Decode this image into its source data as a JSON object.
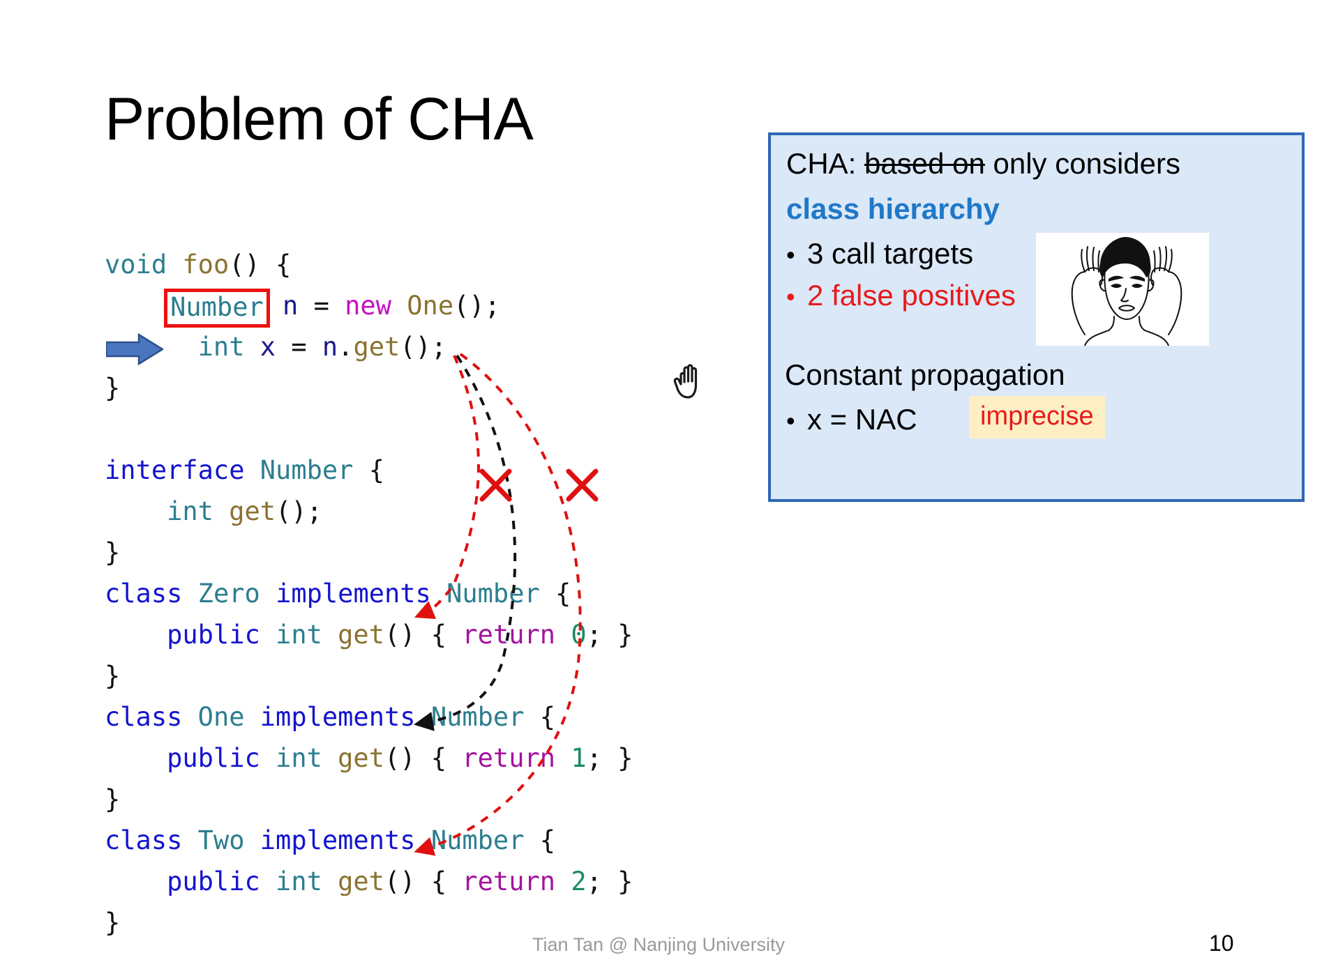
{
  "slide": {
    "title": "Problem of CHA",
    "page_number": "10",
    "footer": "Tian Tan @ Nanjing University"
  },
  "code": {
    "lines": [
      {
        "id": "line-void-foo",
        "tokens": [
          {
            "t": "void",
            "c": "type"
          },
          {
            "t": " ",
            "c": "punc"
          },
          {
            "t": "foo",
            "c": "meth"
          },
          {
            "t": "() {",
            "c": "punc"
          }
        ]
      },
      {
        "id": "line-number-n",
        "tokens": [
          {
            "t": "    ",
            "c": "punc"
          },
          {
            "t": "Number",
            "c": "type",
            "box": true
          },
          {
            "t": " ",
            "c": "punc"
          },
          {
            "t": "n",
            "c": "var"
          },
          {
            "t": " = ",
            "c": "punc"
          },
          {
            "t": "new",
            "c": "newkw"
          },
          {
            "t": " ",
            "c": "punc"
          },
          {
            "t": "One",
            "c": "meth"
          },
          {
            "t": "();",
            "c": "punc"
          }
        ]
      },
      {
        "id": "line-int-x",
        "tokens": [
          {
            "t": "      ",
            "c": "punc"
          },
          {
            "t": "int",
            "c": "type"
          },
          {
            "t": " ",
            "c": "punc"
          },
          {
            "t": "x",
            "c": "var"
          },
          {
            "t": " = ",
            "c": "punc"
          },
          {
            "t": "n",
            "c": "var"
          },
          {
            "t": ".",
            "c": "punc"
          },
          {
            "t": "get",
            "c": "meth"
          },
          {
            "t": "();",
            "c": "punc"
          }
        ]
      },
      {
        "id": "line-close-foo",
        "tokens": [
          {
            "t": "}",
            "c": "punc"
          }
        ]
      },
      {
        "id": "line-blank-1",
        "tokens": [
          {
            "t": " ",
            "c": "punc"
          }
        ]
      },
      {
        "id": "line-interface",
        "tokens": [
          {
            "t": "interface",
            "c": "kw"
          },
          {
            "t": " ",
            "c": "punc"
          },
          {
            "t": "Number",
            "c": "type"
          },
          {
            "t": " {",
            "c": "punc"
          }
        ]
      },
      {
        "id": "line-int-get",
        "tokens": [
          {
            "t": "    ",
            "c": "punc"
          },
          {
            "t": "int",
            "c": "type"
          },
          {
            "t": " ",
            "c": "punc"
          },
          {
            "t": "get",
            "c": "meth"
          },
          {
            "t": "();",
            "c": "punc"
          }
        ]
      },
      {
        "id": "line-close-interface",
        "tokens": [
          {
            "t": "}",
            "c": "punc"
          }
        ]
      },
      {
        "id": "line-class-zero",
        "tokens": [
          {
            "t": "class",
            "c": "kw"
          },
          {
            "t": " ",
            "c": "punc"
          },
          {
            "t": "Zero",
            "c": "type"
          },
          {
            "t": " ",
            "c": "punc"
          },
          {
            "t": "implements",
            "c": "kw"
          },
          {
            "t": " ",
            "c": "punc"
          },
          {
            "t": "Number",
            "c": "type"
          },
          {
            "t": " {",
            "c": "punc"
          }
        ]
      },
      {
        "id": "line-zero-get",
        "tokens": [
          {
            "t": "    ",
            "c": "punc"
          },
          {
            "t": "public",
            "c": "kw"
          },
          {
            "t": " ",
            "c": "punc"
          },
          {
            "t": "int",
            "c": "type"
          },
          {
            "t": " ",
            "c": "punc"
          },
          {
            "t": "get",
            "c": "meth"
          },
          {
            "t": "() { ",
            "c": "punc"
          },
          {
            "t": "return",
            "c": "ret"
          },
          {
            "t": " ",
            "c": "punc"
          },
          {
            "t": "0",
            "c": "num"
          },
          {
            "t": "; }",
            "c": "punc"
          }
        ]
      },
      {
        "id": "line-close-zero",
        "tokens": [
          {
            "t": "}",
            "c": "punc"
          }
        ]
      },
      {
        "id": "line-class-one",
        "tokens": [
          {
            "t": "class",
            "c": "kw"
          },
          {
            "t": " ",
            "c": "punc"
          },
          {
            "t": "One",
            "c": "type"
          },
          {
            "t": " ",
            "c": "punc"
          },
          {
            "t": "implements",
            "c": "kw"
          },
          {
            "t": " ",
            "c": "punc"
          },
          {
            "t": "Number",
            "c": "type"
          },
          {
            "t": " {",
            "c": "punc"
          }
        ]
      },
      {
        "id": "line-one-get",
        "tokens": [
          {
            "t": "    ",
            "c": "punc"
          },
          {
            "t": "public",
            "c": "kw"
          },
          {
            "t": " ",
            "c": "punc"
          },
          {
            "t": "int",
            "c": "type"
          },
          {
            "t": " ",
            "c": "punc"
          },
          {
            "t": "get",
            "c": "meth"
          },
          {
            "t": "() { ",
            "c": "punc"
          },
          {
            "t": "return",
            "c": "ret"
          },
          {
            "t": " ",
            "c": "punc"
          },
          {
            "t": "1",
            "c": "num"
          },
          {
            "t": "; }",
            "c": "punc"
          }
        ]
      },
      {
        "id": "line-close-one",
        "tokens": [
          {
            "t": "}",
            "c": "punc"
          }
        ]
      },
      {
        "id": "line-class-two",
        "tokens": [
          {
            "t": "class",
            "c": "kw"
          },
          {
            "t": " ",
            "c": "punc"
          },
          {
            "t": "Two",
            "c": "type"
          },
          {
            "t": " ",
            "c": "punc"
          },
          {
            "t": "implements",
            "c": "kw"
          },
          {
            "t": " ",
            "c": "punc"
          },
          {
            "t": "Number",
            "c": "type"
          },
          {
            "t": " {",
            "c": "punc"
          }
        ]
      },
      {
        "id": "line-two-get",
        "tokens": [
          {
            "t": "    ",
            "c": "punc"
          },
          {
            "t": "public",
            "c": "kw"
          },
          {
            "t": " ",
            "c": "punc"
          },
          {
            "t": "int",
            "c": "type"
          },
          {
            "t": " ",
            "c": "punc"
          },
          {
            "t": "get",
            "c": "meth"
          },
          {
            "t": "() { ",
            "c": "punc"
          },
          {
            "t": "return",
            "c": "ret"
          },
          {
            "t": " ",
            "c": "punc"
          },
          {
            "t": "2",
            "c": "num"
          },
          {
            "t": "; }",
            "c": "punc"
          }
        ]
      },
      {
        "id": "line-close-two",
        "tokens": [
          {
            "t": "}",
            "c": "punc"
          }
        ]
      }
    ]
  },
  "info_box": {
    "line1_prefix": "CHA: ",
    "line1_struck": "based on",
    "line1_suffix": " only considers",
    "line2": "class hierarchy",
    "bullet1": "3 call targets",
    "bullet2": "2 false positives",
    "line3": "Constant propagation",
    "bullet3": "x = NAC",
    "imprecise_tag": "imprecise",
    "bullet_glyph": "•"
  },
  "annotations": {
    "call_edge_labels": [
      "false-positive-to-zero",
      "true-target-to-one",
      "false-positive-to-two"
    ],
    "x_mark_label": "X"
  },
  "colors": {
    "info_box_bg": "#dbe8f7",
    "info_box_border": "#2e66b5",
    "accent_blue": "#1f78c8",
    "red": "#e81a1a",
    "imprecise_bg": "#fdeec4",
    "highlight_box": "#ee1111",
    "arrow_blue": "#4a76c0"
  }
}
